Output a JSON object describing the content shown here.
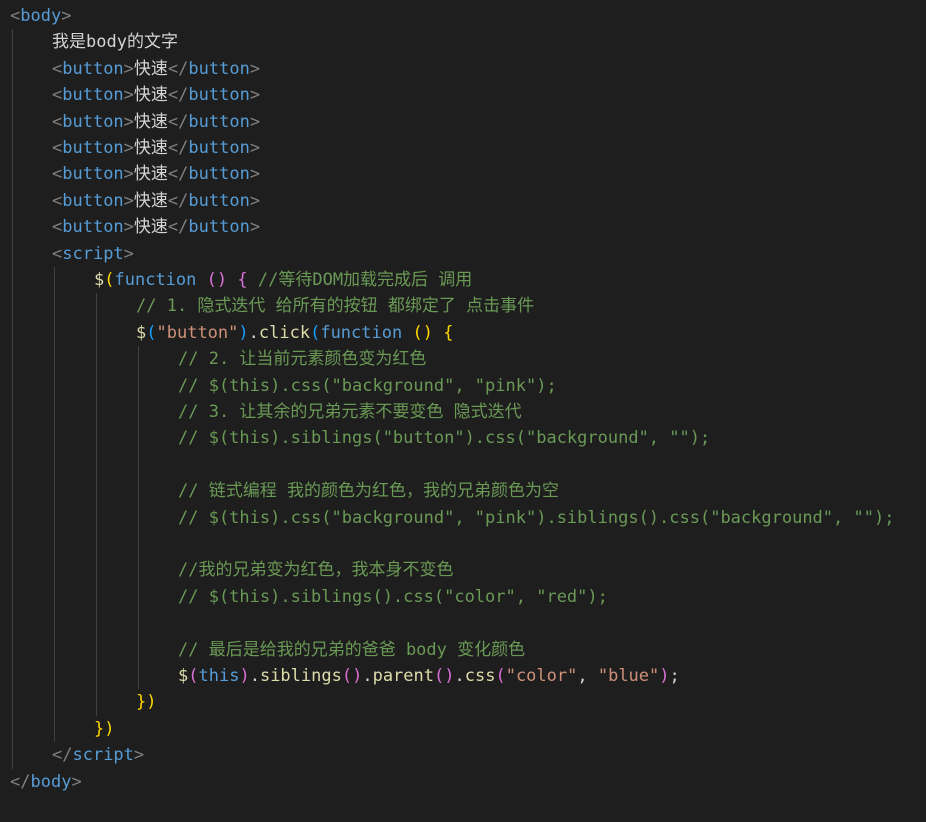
{
  "code_editor": {
    "language": "html",
    "colors": {
      "background": "#1e1e1e",
      "tag": "#569cd6",
      "tag_bracket": "#808080",
      "text": "#d4d4d4",
      "comment": "#6a9955",
      "string": "#ce9178",
      "keyword": "#569cd6",
      "function": "#dcdcaa",
      "variable": "#9cdcfe",
      "bracket_level_1": "#ffd700",
      "bracket_level_2": "#da70d6",
      "bracket_level_3": "#179fff"
    },
    "lines": [
      {
        "indent": 0,
        "tokens": [
          [
            "tk-punc",
            "<"
          ],
          [
            "tk-tag",
            "body"
          ],
          [
            "tk-punc",
            ">"
          ]
        ]
      },
      {
        "indent": 1,
        "tokens": [
          [
            "tk-txt",
            "我是body的文字"
          ]
        ]
      },
      {
        "indent": 1,
        "tokens": [
          [
            "tk-punc",
            "<"
          ],
          [
            "tk-tag",
            "button"
          ],
          [
            "tk-punc",
            ">"
          ],
          [
            "tk-txt",
            "快速"
          ],
          [
            "tk-punc",
            "</"
          ],
          [
            "tk-tag",
            "button"
          ],
          [
            "tk-punc",
            ">"
          ]
        ]
      },
      {
        "indent": 1,
        "tokens": [
          [
            "tk-punc",
            "<"
          ],
          [
            "tk-tag",
            "button"
          ],
          [
            "tk-punc",
            ">"
          ],
          [
            "tk-txt",
            "快速"
          ],
          [
            "tk-punc",
            "</"
          ],
          [
            "tk-tag",
            "button"
          ],
          [
            "tk-punc",
            ">"
          ]
        ]
      },
      {
        "indent": 1,
        "tokens": [
          [
            "tk-punc",
            "<"
          ],
          [
            "tk-tag",
            "button"
          ],
          [
            "tk-punc",
            ">"
          ],
          [
            "tk-txt",
            "快速"
          ],
          [
            "tk-punc",
            "</"
          ],
          [
            "tk-tag",
            "button"
          ],
          [
            "tk-punc",
            ">"
          ]
        ]
      },
      {
        "indent": 1,
        "tokens": [
          [
            "tk-punc",
            "<"
          ],
          [
            "tk-tag",
            "button"
          ],
          [
            "tk-punc",
            ">"
          ],
          [
            "tk-txt",
            "快速"
          ],
          [
            "tk-punc",
            "</"
          ],
          [
            "tk-tag",
            "button"
          ],
          [
            "tk-punc",
            ">"
          ]
        ]
      },
      {
        "indent": 1,
        "tokens": [
          [
            "tk-punc",
            "<"
          ],
          [
            "tk-tag",
            "button"
          ],
          [
            "tk-punc",
            ">"
          ],
          [
            "tk-txt",
            "快速"
          ],
          [
            "tk-punc",
            "</"
          ],
          [
            "tk-tag",
            "button"
          ],
          [
            "tk-punc",
            ">"
          ]
        ]
      },
      {
        "indent": 1,
        "tokens": [
          [
            "tk-punc",
            "<"
          ],
          [
            "tk-tag",
            "button"
          ],
          [
            "tk-punc",
            ">"
          ],
          [
            "tk-txt",
            "快速"
          ],
          [
            "tk-punc",
            "</"
          ],
          [
            "tk-tag",
            "button"
          ],
          [
            "tk-punc",
            ">"
          ]
        ]
      },
      {
        "indent": 1,
        "tokens": [
          [
            "tk-punc",
            "<"
          ],
          [
            "tk-tag",
            "button"
          ],
          [
            "tk-punc",
            ">"
          ],
          [
            "tk-txt",
            "快速"
          ],
          [
            "tk-punc",
            "</"
          ],
          [
            "tk-tag",
            "button"
          ],
          [
            "tk-punc",
            ">"
          ]
        ]
      },
      {
        "indent": 1,
        "tokens": [
          [
            "tk-punc",
            "<"
          ],
          [
            "tk-tag",
            "script"
          ],
          [
            "tk-punc",
            ">"
          ]
        ]
      },
      {
        "indent": 2,
        "tokens": [
          [
            "tk-fn",
            "$"
          ],
          [
            "tk-b1",
            "("
          ],
          [
            "tk-kw",
            "function"
          ],
          [
            "tk-txt",
            " "
          ],
          [
            "tk-b2",
            "()"
          ],
          [
            "tk-txt",
            " "
          ],
          [
            "tk-b2",
            "{"
          ],
          [
            "tk-txt",
            " "
          ],
          [
            "tk-cmt",
            "//等待DOM加载完成后 调用"
          ]
        ]
      },
      {
        "indent": 3,
        "tokens": [
          [
            "tk-cmt",
            "// 1. 隐式迭代 给所有的按钮 都绑定了 点击事件"
          ]
        ]
      },
      {
        "indent": 3,
        "tokens": [
          [
            "tk-fn",
            "$"
          ],
          [
            "tk-b3",
            "("
          ],
          [
            "tk-str",
            "\"button\""
          ],
          [
            "tk-b3",
            ")"
          ],
          [
            "tk-txt",
            "."
          ],
          [
            "tk-fn",
            "click"
          ],
          [
            "tk-b3",
            "("
          ],
          [
            "tk-kw",
            "function"
          ],
          [
            "tk-txt",
            " "
          ],
          [
            "tk-b1",
            "()"
          ],
          [
            "tk-txt",
            " "
          ],
          [
            "tk-b1",
            "{"
          ]
        ]
      },
      {
        "indent": 4,
        "tokens": [
          [
            "tk-cmt",
            "// 2. 让当前元素颜色变为红色"
          ]
        ]
      },
      {
        "indent": 4,
        "tokens": [
          [
            "tk-cmt",
            "// $(this).css(\"background\", \"pink\");"
          ]
        ]
      },
      {
        "indent": 4,
        "tokens": [
          [
            "tk-cmt",
            "// 3. 让其余的兄弟元素不要变色 隐式迭代"
          ]
        ]
      },
      {
        "indent": 4,
        "tokens": [
          [
            "tk-cmt",
            "// $(this).siblings(\"button\").css(\"background\", \"\");"
          ]
        ]
      },
      {
        "indent": 4,
        "tokens": []
      },
      {
        "indent": 4,
        "tokens": [
          [
            "tk-cmt",
            "// 链式编程 我的颜色为红色，我的兄弟颜色为空"
          ]
        ]
      },
      {
        "indent": 4,
        "tokens": [
          [
            "tk-cmt",
            "// $(this).css(\"background\", \"pink\").siblings().css(\"background\", \"\");"
          ]
        ]
      },
      {
        "indent": 4,
        "tokens": []
      },
      {
        "indent": 4,
        "tokens": [
          [
            "tk-cmt",
            "//我的兄弟变为红色，我本身不变色"
          ]
        ]
      },
      {
        "indent": 4,
        "tokens": [
          [
            "tk-cmt",
            "// $(this).siblings().css(\"color\", \"red\");"
          ]
        ]
      },
      {
        "indent": 4,
        "tokens": []
      },
      {
        "indent": 4,
        "tokens": [
          [
            "tk-cmt",
            "// 最后是给我的兄弟的爸爸 body 变化颜色"
          ]
        ]
      },
      {
        "indent": 4,
        "tokens": [
          [
            "tk-fn",
            "$"
          ],
          [
            "tk-b2",
            "("
          ],
          [
            "tk-kw",
            "this"
          ],
          [
            "tk-b2",
            ")"
          ],
          [
            "tk-txt",
            "."
          ],
          [
            "tk-fn",
            "siblings"
          ],
          [
            "tk-b2",
            "()"
          ],
          [
            "tk-txt",
            "."
          ],
          [
            "tk-fn",
            "parent"
          ],
          [
            "tk-b2",
            "()"
          ],
          [
            "tk-txt",
            "."
          ],
          [
            "tk-fn",
            "css"
          ],
          [
            "tk-b2",
            "("
          ],
          [
            "tk-str",
            "\"color\""
          ],
          [
            "tk-txt",
            ", "
          ],
          [
            "tk-str",
            "\"blue\""
          ],
          [
            "tk-b2",
            ")"
          ],
          [
            "tk-txt",
            ";"
          ]
        ]
      },
      {
        "indent": 3,
        "tokens": [
          [
            "tk-b1",
            "})"
          ]
        ]
      },
      {
        "indent": 2,
        "tokens": [
          [
            "tk-b1",
            "})"
          ]
        ]
      },
      {
        "indent": 1,
        "tokens": [
          [
            "tk-punc",
            "</"
          ],
          [
            "tk-tag",
            "script"
          ],
          [
            "tk-punc",
            ">"
          ]
        ]
      },
      {
        "indent": 0,
        "tokens": [
          [
            "tk-punc",
            "</"
          ],
          [
            "tk-tag",
            "body"
          ],
          [
            "tk-punc",
            ">"
          ]
        ]
      }
    ]
  }
}
